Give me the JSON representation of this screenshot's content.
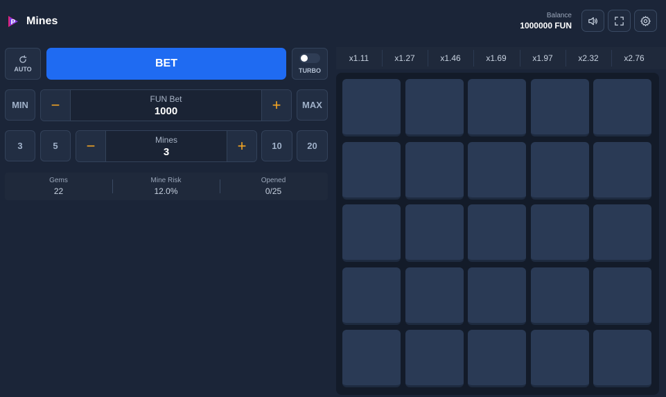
{
  "header": {
    "title": "Mines",
    "logo_icon": "pragmatic-play-logo-icon",
    "balance_label": "Balance",
    "balance_value": "1000000 FUN"
  },
  "controls": {
    "auto_label": "AUTO",
    "bet_label": "BET",
    "turbo_label": "TURBO",
    "turbo_on": false,
    "bet_min_label": "MIN",
    "bet_max_label": "MAX",
    "bet_label_text": "FUN Bet",
    "bet_value": "1000",
    "mines_presets": [
      "3",
      "5",
      "10",
      "20"
    ],
    "mines_label": "Mines",
    "mines_value": "3",
    "minus_symbol": "−",
    "plus_symbol": "+"
  },
  "stats": [
    {
      "label": "Gems",
      "value": "22"
    },
    {
      "label": "Mine Risk",
      "value": "12.0%"
    },
    {
      "label": "Opened",
      "value": "0/25"
    }
  ],
  "multipliers": [
    "x1.11",
    "x1.27",
    "x1.46",
    "x1.69",
    "x1.97",
    "x2.32",
    "x2.76"
  ],
  "grid": {
    "rows": 5,
    "cols": 5
  },
  "colors": {
    "accent": "#1f6bf2",
    "stepper_symbol": "#f5a623",
    "background": "#1b2538",
    "tile": "#2a3a55"
  }
}
